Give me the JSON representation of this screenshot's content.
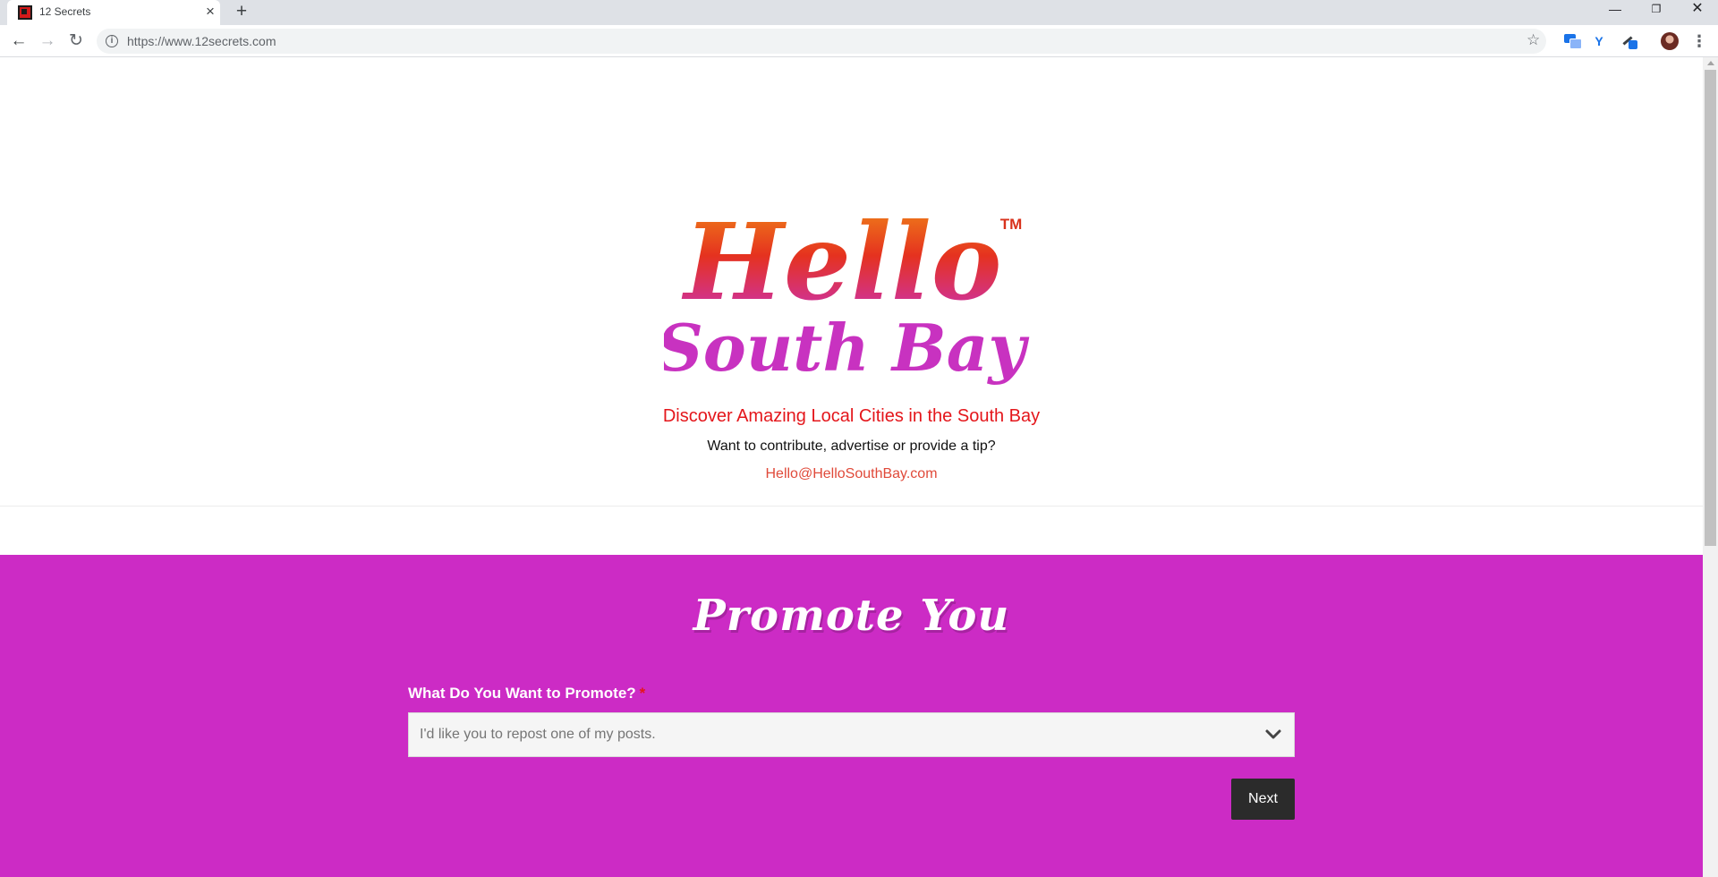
{
  "browser": {
    "tab_title": "12 Secrets",
    "url": "https://www.12secrets.com",
    "icons": {
      "tab_close": "×",
      "new_tab": "+",
      "back": "←",
      "forward": "→",
      "reload": "↻",
      "info": "i",
      "star": "☆",
      "menu": "⋮",
      "minimize": "—",
      "maximize": "❐",
      "close": "✕",
      "extension_2": "Y"
    }
  },
  "header": {
    "logo_line1": "Hello",
    "logo_line2": "South Bay",
    "logo_trademark": "TM",
    "tagline": "Discover Amazing Local Cities in the South Bay",
    "subline": "Want to contribute, advertise or provide a tip?",
    "email": "Hello@HelloSouthBay.com"
  },
  "promote": {
    "title": "Promote You",
    "question_label": "What Do You Want to Promote?",
    "required_mark": "*",
    "selected_option": "I'd like you to repost one of my posts.",
    "next_label": "Next"
  },
  "colors": {
    "accent_red": "#e4161b",
    "promo_bg": "#cc2bc5",
    "button_dark": "#2b2b2b",
    "logo_gradient_top": "#f08a18",
    "logo_gradient_bottom": "#c832c0"
  }
}
